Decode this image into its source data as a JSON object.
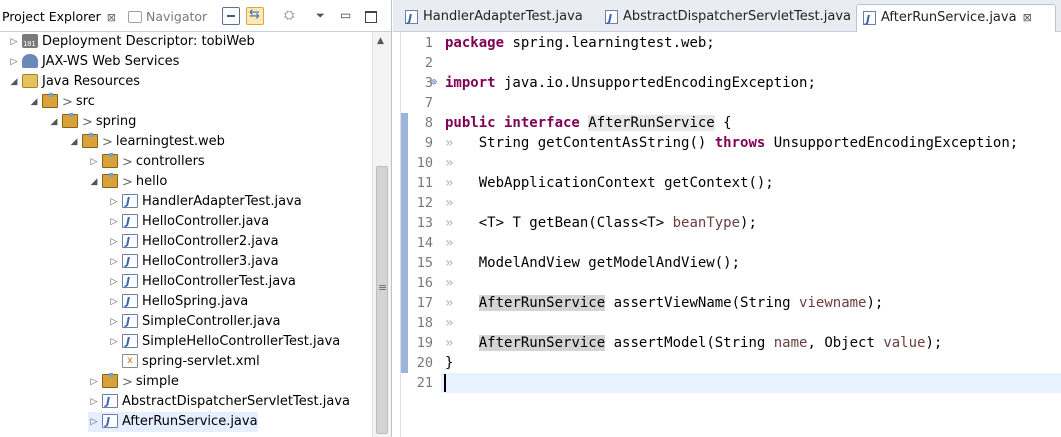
{
  "left_panel": {
    "tabs": {
      "project_explorer": "Project Explorer",
      "project_explorer_close": "⊠",
      "navigator": "Navigator"
    },
    "toolbar": {
      "collapse_all": "collapse-all-icon",
      "link_with_editor": "link-with-editor-icon",
      "view_menu": "⏷",
      "minimize": "▭",
      "maximize": "maximize-icon"
    },
    "tree": [
      {
        "label": "Deployment Descriptor: tobiWeb",
        "prefix": "",
        "twisty": "▷",
        "icon": "deployment-descriptor-icon"
      },
      {
        "label": "JAX-WS Web Services",
        "prefix": "",
        "twisty": "▷",
        "icon": "web-services-icon"
      },
      {
        "label": "Java Resources",
        "prefix": "",
        "twisty": "◢",
        "icon": "java-resources-icon"
      },
      {
        "label": "src",
        "prefix": ">",
        "twisty": "◢",
        "icon": "source-folder-icon"
      },
      {
        "label": "spring",
        "prefix": ">",
        "twisty": "◢",
        "icon": "package-icon"
      },
      {
        "label": "learningtest.web",
        "prefix": ">",
        "twisty": "◢",
        "icon": "package-icon"
      },
      {
        "label": "controllers",
        "prefix": ">",
        "twisty": "▷",
        "icon": "package-icon"
      },
      {
        "label": "hello",
        "prefix": ">",
        "twisty": "◢",
        "icon": "package-icon"
      },
      {
        "label": "HandlerAdapterTest.java",
        "prefix": "",
        "twisty": "▷",
        "icon": "java-file-icon"
      },
      {
        "label": "HelloController.java",
        "prefix": "",
        "twisty": "▷",
        "icon": "java-file-icon"
      },
      {
        "label": "HelloController2.java",
        "prefix": "",
        "twisty": "▷",
        "icon": "java-file-icon"
      },
      {
        "label": "HelloController3.java",
        "prefix": "",
        "twisty": "▷",
        "icon": "java-file-icon"
      },
      {
        "label": "HelloControllerTest.java",
        "prefix": "",
        "twisty": "▷",
        "icon": "java-file-icon"
      },
      {
        "label": "HelloSpring.java",
        "prefix": "",
        "twisty": "▷",
        "icon": "java-file-icon"
      },
      {
        "label": "SimpleController.java",
        "prefix": "",
        "twisty": "▷",
        "icon": "java-file-icon"
      },
      {
        "label": "SimpleHelloControllerTest.java",
        "prefix": "",
        "twisty": "▷",
        "icon": "java-file-icon"
      },
      {
        "label": "spring-servlet.xml",
        "prefix": "",
        "twisty": "",
        "icon": "xml-file-icon"
      },
      {
        "label": "simple",
        "prefix": ">",
        "twisty": "▷",
        "icon": "package-icon"
      },
      {
        "label": "AbstractDispatcherServletTest.java",
        "prefix": "",
        "twisty": "▷",
        "icon": "java-file-icon"
      },
      {
        "label": "AfterRunService.java",
        "prefix": "",
        "twisty": "▷",
        "icon": "java-file-icon"
      }
    ]
  },
  "editor": {
    "tabs": [
      {
        "label": "HandlerAdapterTest.java"
      },
      {
        "label": "AbstractDispatcherServletTest.java"
      },
      {
        "label": "AfterRunService.java",
        "close": "⊠"
      }
    ],
    "line_numbers": [
      "1",
      "2",
      "3",
      "7",
      "8",
      "9",
      "10",
      "11",
      "12",
      "13",
      "14",
      "15",
      "16",
      "17",
      "18",
      "19",
      "20",
      "21"
    ],
    "lines": {
      "l1_kw": "package",
      "l1_rest": " spring.learningtest.web;",
      "l3_kw": "import",
      "l3_rest": " java.io.UnsupportedEncodingException;",
      "l8_kw": "public interface",
      "l8_name": "AfterRunService",
      "l8_rest": " {",
      "l9_type": "String",
      "l9_method": " getContentAsString() ",
      "l9_kw": "throws",
      "l9_rest": " UnsupportedEncodingException;",
      "l11_text": "WebApplicationContext getContext();",
      "l13_pre": "<T> T getBean(Class<T> ",
      "l13_param": "beanType",
      "l13_post": ");",
      "l15_text": "ModelAndView getModelAndView();",
      "l17_type": "AfterRunService",
      "l17_pre": " assertViewName(String ",
      "l17_param": "viewname",
      "l17_post": ");",
      "l19_type": "AfterRunService",
      "l19_pre": " assertModel(String ",
      "l19_param1": "name",
      "l19_mid": ", Object ",
      "l19_param2": "value",
      "l19_post": ");",
      "l20_text": "}",
      "whitespace_mark": "»"
    }
  }
}
